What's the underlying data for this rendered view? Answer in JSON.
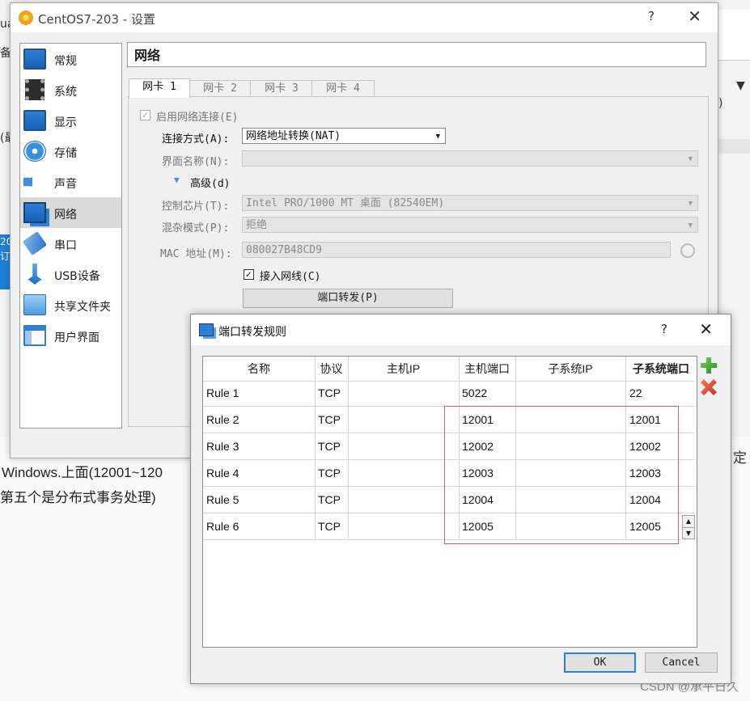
{
  "background": {
    "article_line1": "Windows.上面(12001~120",
    "article_line2": "第五个是分布式事务处理)",
    "frag_a": "ua",
    "frag_b": "备",
    "frag_c": "(最",
    "blue_text": "20 订",
    "watermark": "CSDN @承平日久",
    "right_frag": "▼",
    "right_frag2": ")",
    "right_frag3": "定"
  },
  "settings": {
    "title": "CentOS7-203 - 设置",
    "help": "?",
    "close": "✕",
    "section_title": "网络",
    "sidebar": [
      {
        "label": "常规",
        "icon": "general-icon"
      },
      {
        "label": "系统",
        "icon": "system-icon"
      },
      {
        "label": "显示",
        "icon": "display-icon"
      },
      {
        "label": "存储",
        "icon": "storage-icon"
      },
      {
        "label": "声音",
        "icon": "audio-icon"
      },
      {
        "label": "网络",
        "icon": "network-icon",
        "selected": true
      },
      {
        "label": "串口",
        "icon": "serial-port-icon"
      },
      {
        "label": "USB设备",
        "icon": "usb-icon"
      },
      {
        "label": "共享文件夹",
        "icon": "shared-folder-icon"
      },
      {
        "label": "用户界面",
        "icon": "user-interface-icon"
      }
    ],
    "tabs": [
      "网卡 1",
      "网卡 2",
      "网卡 3",
      "网卡 4"
    ],
    "enable_adapter": "启用网络连接(E)",
    "attached_to_label": "连接方式(A):",
    "attached_to_value": "网络地址转换(NAT)",
    "name_label": "界面名称(N):",
    "name_value": "",
    "advanced": "高级(d)",
    "adapter_type_label": "控制芯片(T):",
    "adapter_type_value": "Intel PRO/1000 MT 桌面 (82540EM)",
    "promisc_label": "混杂模式(P):",
    "promisc_value": "拒绝",
    "mac_label": "MAC 地址(M):",
    "mac_value": "080027B48CD9",
    "cable_connected": "接入网线(C)",
    "port_forwarding_btn": "端口转发(P)"
  },
  "port_forwarding": {
    "title": "端口转发规则",
    "help": "?",
    "close": "✕",
    "columns": [
      "名称",
      "协议",
      "主机IP",
      "主机端口",
      "子系统IP",
      "子系统端口"
    ],
    "rows": [
      {
        "name": "Rule 1",
        "protocol": "TCP",
        "host_ip": "",
        "host_port": "5022",
        "guest_ip": "",
        "guest_port": "22"
      },
      {
        "name": "Rule 2",
        "protocol": "TCP",
        "host_ip": "",
        "host_port": "12001",
        "guest_ip": "",
        "guest_port": "12001"
      },
      {
        "name": "Rule 3",
        "protocol": "TCP",
        "host_ip": "",
        "host_port": "12002",
        "guest_ip": "",
        "guest_port": "12002"
      },
      {
        "name": "Rule 4",
        "protocol": "TCP",
        "host_ip": "",
        "host_port": "12003",
        "guest_ip": "",
        "guest_port": "12003"
      },
      {
        "name": "Rule 5",
        "protocol": "TCP",
        "host_ip": "",
        "host_port": "12004",
        "guest_ip": "",
        "guest_port": "12004"
      },
      {
        "name": "Rule 6",
        "protocol": "TCP",
        "host_ip": "",
        "host_port": "12005",
        "guest_ip": "",
        "guest_port": "12005"
      }
    ],
    "ok": "OK",
    "cancel": "Cancel",
    "highlight_color": "#e05a5a"
  }
}
